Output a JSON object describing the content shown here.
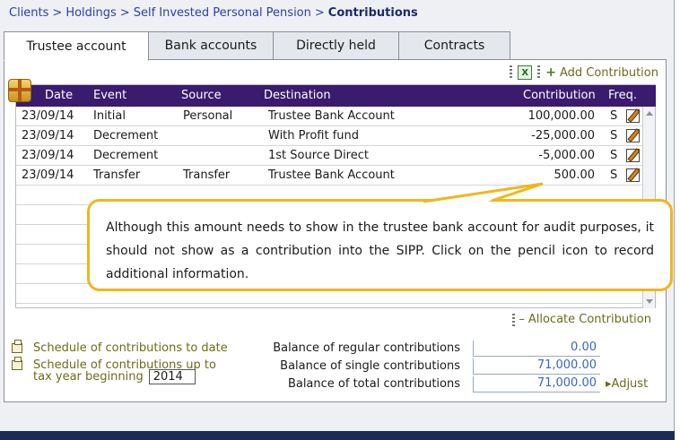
{
  "breadcrumb": {
    "clients": "Clients",
    "holdings": "Holdings",
    "sipp": "Self Invested Personal Pension",
    "current": "Contributions",
    "separator": ">"
  },
  "tabs": [
    {
      "label": "Trustee account",
      "active": true
    },
    {
      "label": "Bank accounts",
      "active": false
    },
    {
      "label": "Directly held",
      "active": false
    },
    {
      "label": "Contracts",
      "active": false
    }
  ],
  "toolbar": {
    "excel_icon": "excel-icon",
    "add_contribution": "Add Contribution"
  },
  "table": {
    "headers": {
      "date": "Date",
      "event": "Event",
      "source": "Source",
      "destination": "Destination",
      "contribution": "Contribution",
      "freq": "Freq."
    },
    "rows": [
      {
        "date": "23/09/14",
        "event": "Initial",
        "source": "Personal",
        "destination": "Trustee Bank Account",
        "contribution": "100,000.00",
        "freq": "S"
      },
      {
        "date": "23/09/14",
        "event": "Decrement",
        "source": "",
        "destination": "With Profit fund",
        "contribution": "-25,000.00",
        "freq": "S"
      },
      {
        "date": "23/09/14",
        "event": "Decrement",
        "source": "",
        "destination": "1st Source Direct",
        "contribution": "-5,000.00",
        "freq": "S"
      },
      {
        "date": "23/09/14",
        "event": "Transfer",
        "source": "Transfer",
        "destination": "Trustee Bank Account",
        "contribution": "500.00",
        "freq": "S"
      }
    ]
  },
  "allocate_contribution": "Allocate Contribution",
  "links": {
    "schedule_to_date": "Schedule of contributions to date",
    "schedule_up_to": "Schedule of contributions up to",
    "tax_year_label": "tax year beginning",
    "tax_year_value": "2014"
  },
  "balances": {
    "regular_label": "Balance of regular contributions",
    "regular_value": "0.00",
    "single_label": "Balance of single contributions",
    "single_value": "71,000.00",
    "total_label": "Balance of total contributions",
    "total_value": "71,000.00",
    "adjust": "Adjust"
  },
  "callout": {
    "text": "Although this amount needs to show in the trustee bank account for audit purposes, it should not show as a contribution into the SIPP. Click on the pencil icon to record additional information."
  },
  "colors": {
    "header_bg": "#3a1b6e",
    "link_blue": "#2b3fa8",
    "action_olive": "#6b6b1a",
    "callout_border": "#f2b51c",
    "value_blue": "#3c63c9"
  }
}
